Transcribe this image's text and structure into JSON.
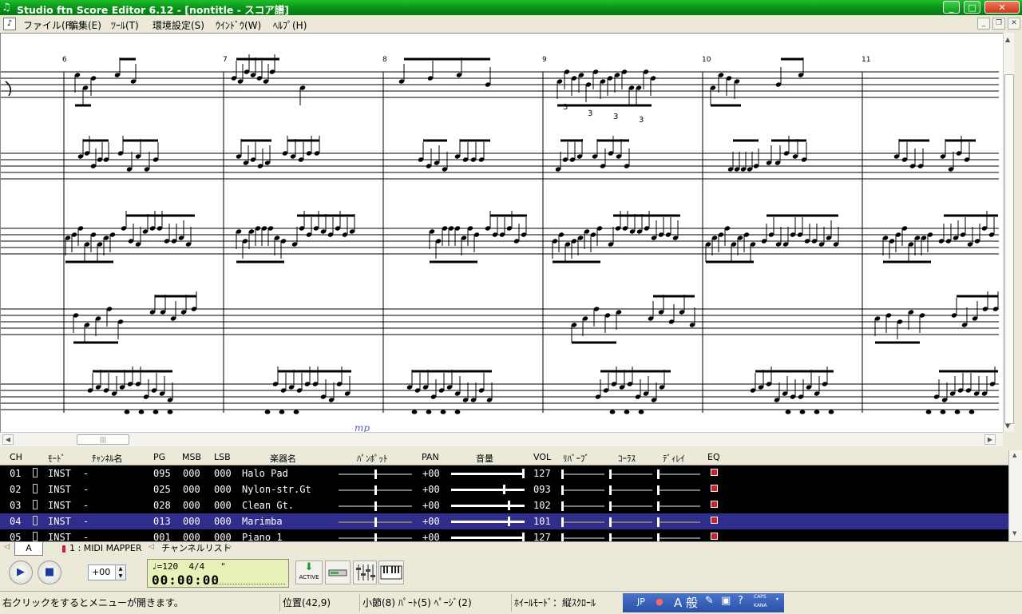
{
  "window": {
    "title": "Studio ftn Score Editor 6.12 - [nontitle - スコア譜]",
    "btn_min": "_",
    "btn_max": "□",
    "btn_close": "✕"
  },
  "menu": [
    "ファイル(F)",
    "編集(E)",
    "ﾂｰﾙ(T)",
    "環境設定(S)",
    "ｳｲﾝﾄﾞｳ(W)",
    "ﾍﾙﾌﾟ(H)"
  ],
  "score": {
    "measure_numbers": [
      "6",
      "7",
      "8",
      "9",
      "10",
      "11"
    ],
    "triplet_marks": [
      "3",
      "3",
      "3",
      "3"
    ],
    "dynamic": "mp"
  },
  "mixer": {
    "headers": [
      "CH",
      "ﾓｰﾄﾞ",
      "ﾁｬﾝﾈﾙ名",
      "PG",
      "MSB",
      "LSB",
      "楽器名",
      "ﾊﾟﾝﾎﾟｯﾄ",
      "PAN",
      "音量",
      "VOL",
      "ﾘﾊﾞｰﾌﾞ",
      "ｺｰﾗｽ",
      "ﾃﾞｨﾚｲ",
      "EQ"
    ],
    "rows": [
      {
        "ch": "01",
        "mode": "INST",
        "name": "-",
        "pg": "095",
        "msb": "000",
        "lsb": "000",
        "inst": "Halo Pad",
        "pan": "+00",
        "vol": "127",
        "vol_level": 1.0
      },
      {
        "ch": "02",
        "mode": "INST",
        "name": "-",
        "pg": "025",
        "msb": "000",
        "lsb": "000",
        "inst": "Nylon-str.Gt",
        "pan": "+00",
        "vol": "093",
        "vol_level": 0.73
      },
      {
        "ch": "03",
        "mode": "INST",
        "name": "-",
        "pg": "028",
        "msb": "000",
        "lsb": "000",
        "inst": "Clean Gt.",
        "pan": "+00",
        "vol": "102",
        "vol_level": 0.8
      },
      {
        "ch": "04",
        "mode": "INST",
        "name": "-",
        "pg": "013",
        "msb": "000",
        "lsb": "000",
        "inst": "Marimba",
        "pan": "+00",
        "vol": "101",
        "vol_level": 0.8
      },
      {
        "ch": "05",
        "mode": "INST",
        "name": "-",
        "pg": "001",
        "msb": "000",
        "lsb": "000",
        "inst": "Piano 1",
        "pan": "+00",
        "vol": "127",
        "vol_level": 1.0
      }
    ],
    "selected_row": 3
  },
  "tabs": {
    "active": "A",
    "midi_mapper": "1 : MIDI MAPPER",
    "channel_list": "チャンネルリスト"
  },
  "transport": {
    "play_icon": "▶",
    "stop_icon": "■",
    "transpose": "+00",
    "lcd_line1": "♩=120  4/4   \"",
    "lcd_time": "00:00:00",
    "active_label": "ACTIVE"
  },
  "status": {
    "hint": "右クリックをするとメニューが開きます。",
    "position": "位置(42,9)",
    "measure": "小節(8) ﾊﾟｰﾄ(5) ﾍﾟｰｼﾞ(2)",
    "wheel_mode": "ﾎｲｰﾙﾓｰﾄﾞ：縦ｽｸﾛｰﾙ",
    "ime_lang": "JP",
    "ime_mode": "A 般",
    "caps": "CAPS",
    "kana": "KANA"
  }
}
